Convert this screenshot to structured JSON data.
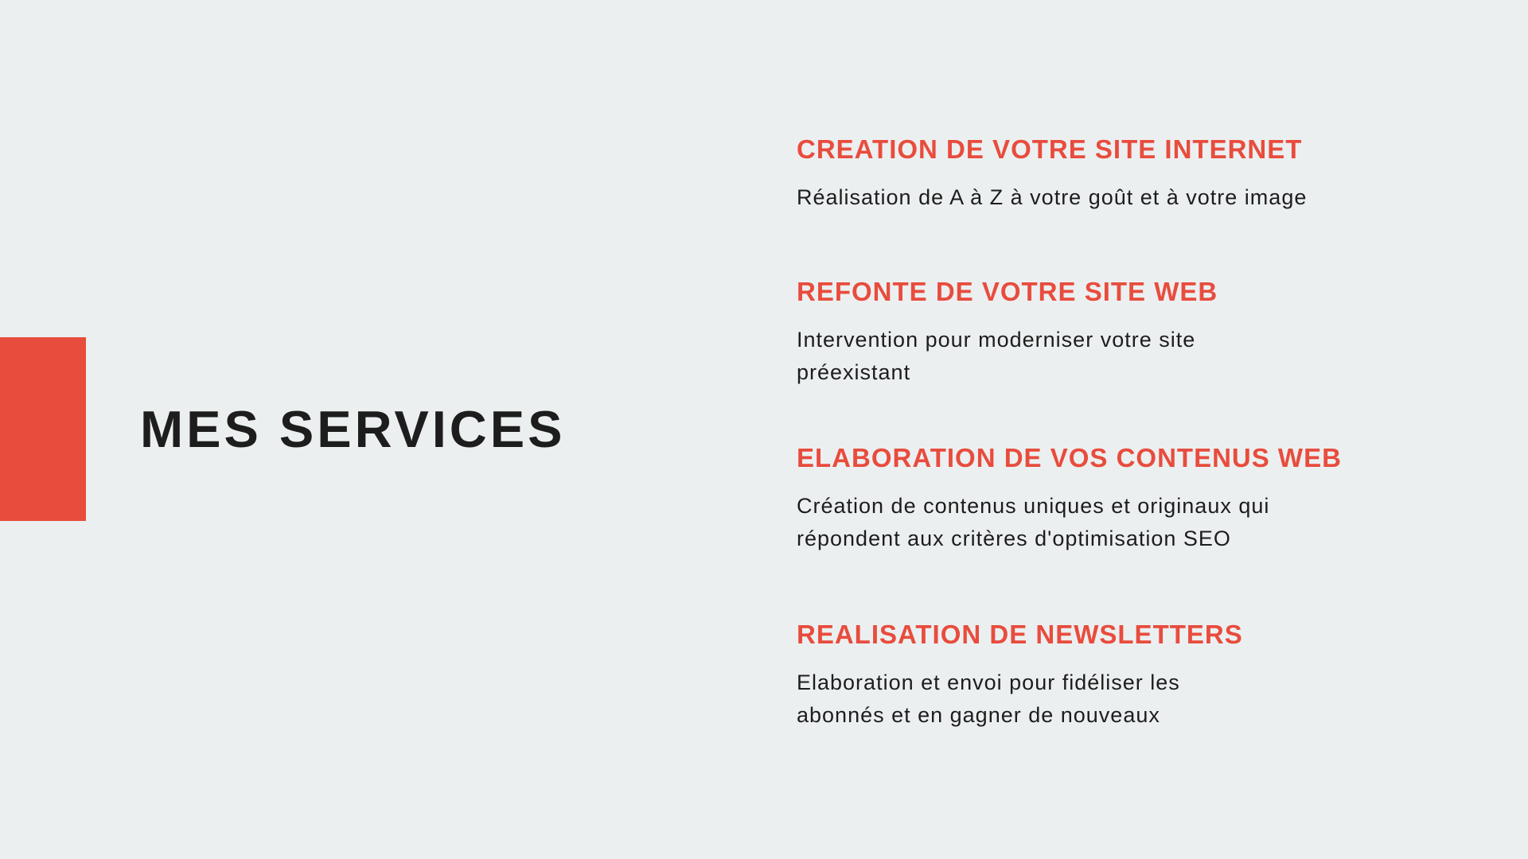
{
  "page": {
    "title": "MES SERVICES",
    "accent_color": "#E84C3D",
    "text_color": "#1D1D1D",
    "background_color": "#ECEFF0"
  },
  "services": [
    {
      "title": "CREATION DE VOTRE SITE INTERNET",
      "description": "Réalisation de A à Z à votre goût et à votre image"
    },
    {
      "title": "REFONTE DE VOTRE SITE WEB",
      "description": "Intervention pour moderniser votre site préexistant"
    },
    {
      "title": "ELABORATION DE VOS CONTENUS WEB",
      "description": "Création de contenus uniques et originaux qui répondent aux critères d'optimisation SEO"
    },
    {
      "title": "REALISATION DE NEWSLETTERS",
      "description": "Elaboration et envoi pour fidéliser les abonnés et en gagner de nouveaux"
    }
  ]
}
